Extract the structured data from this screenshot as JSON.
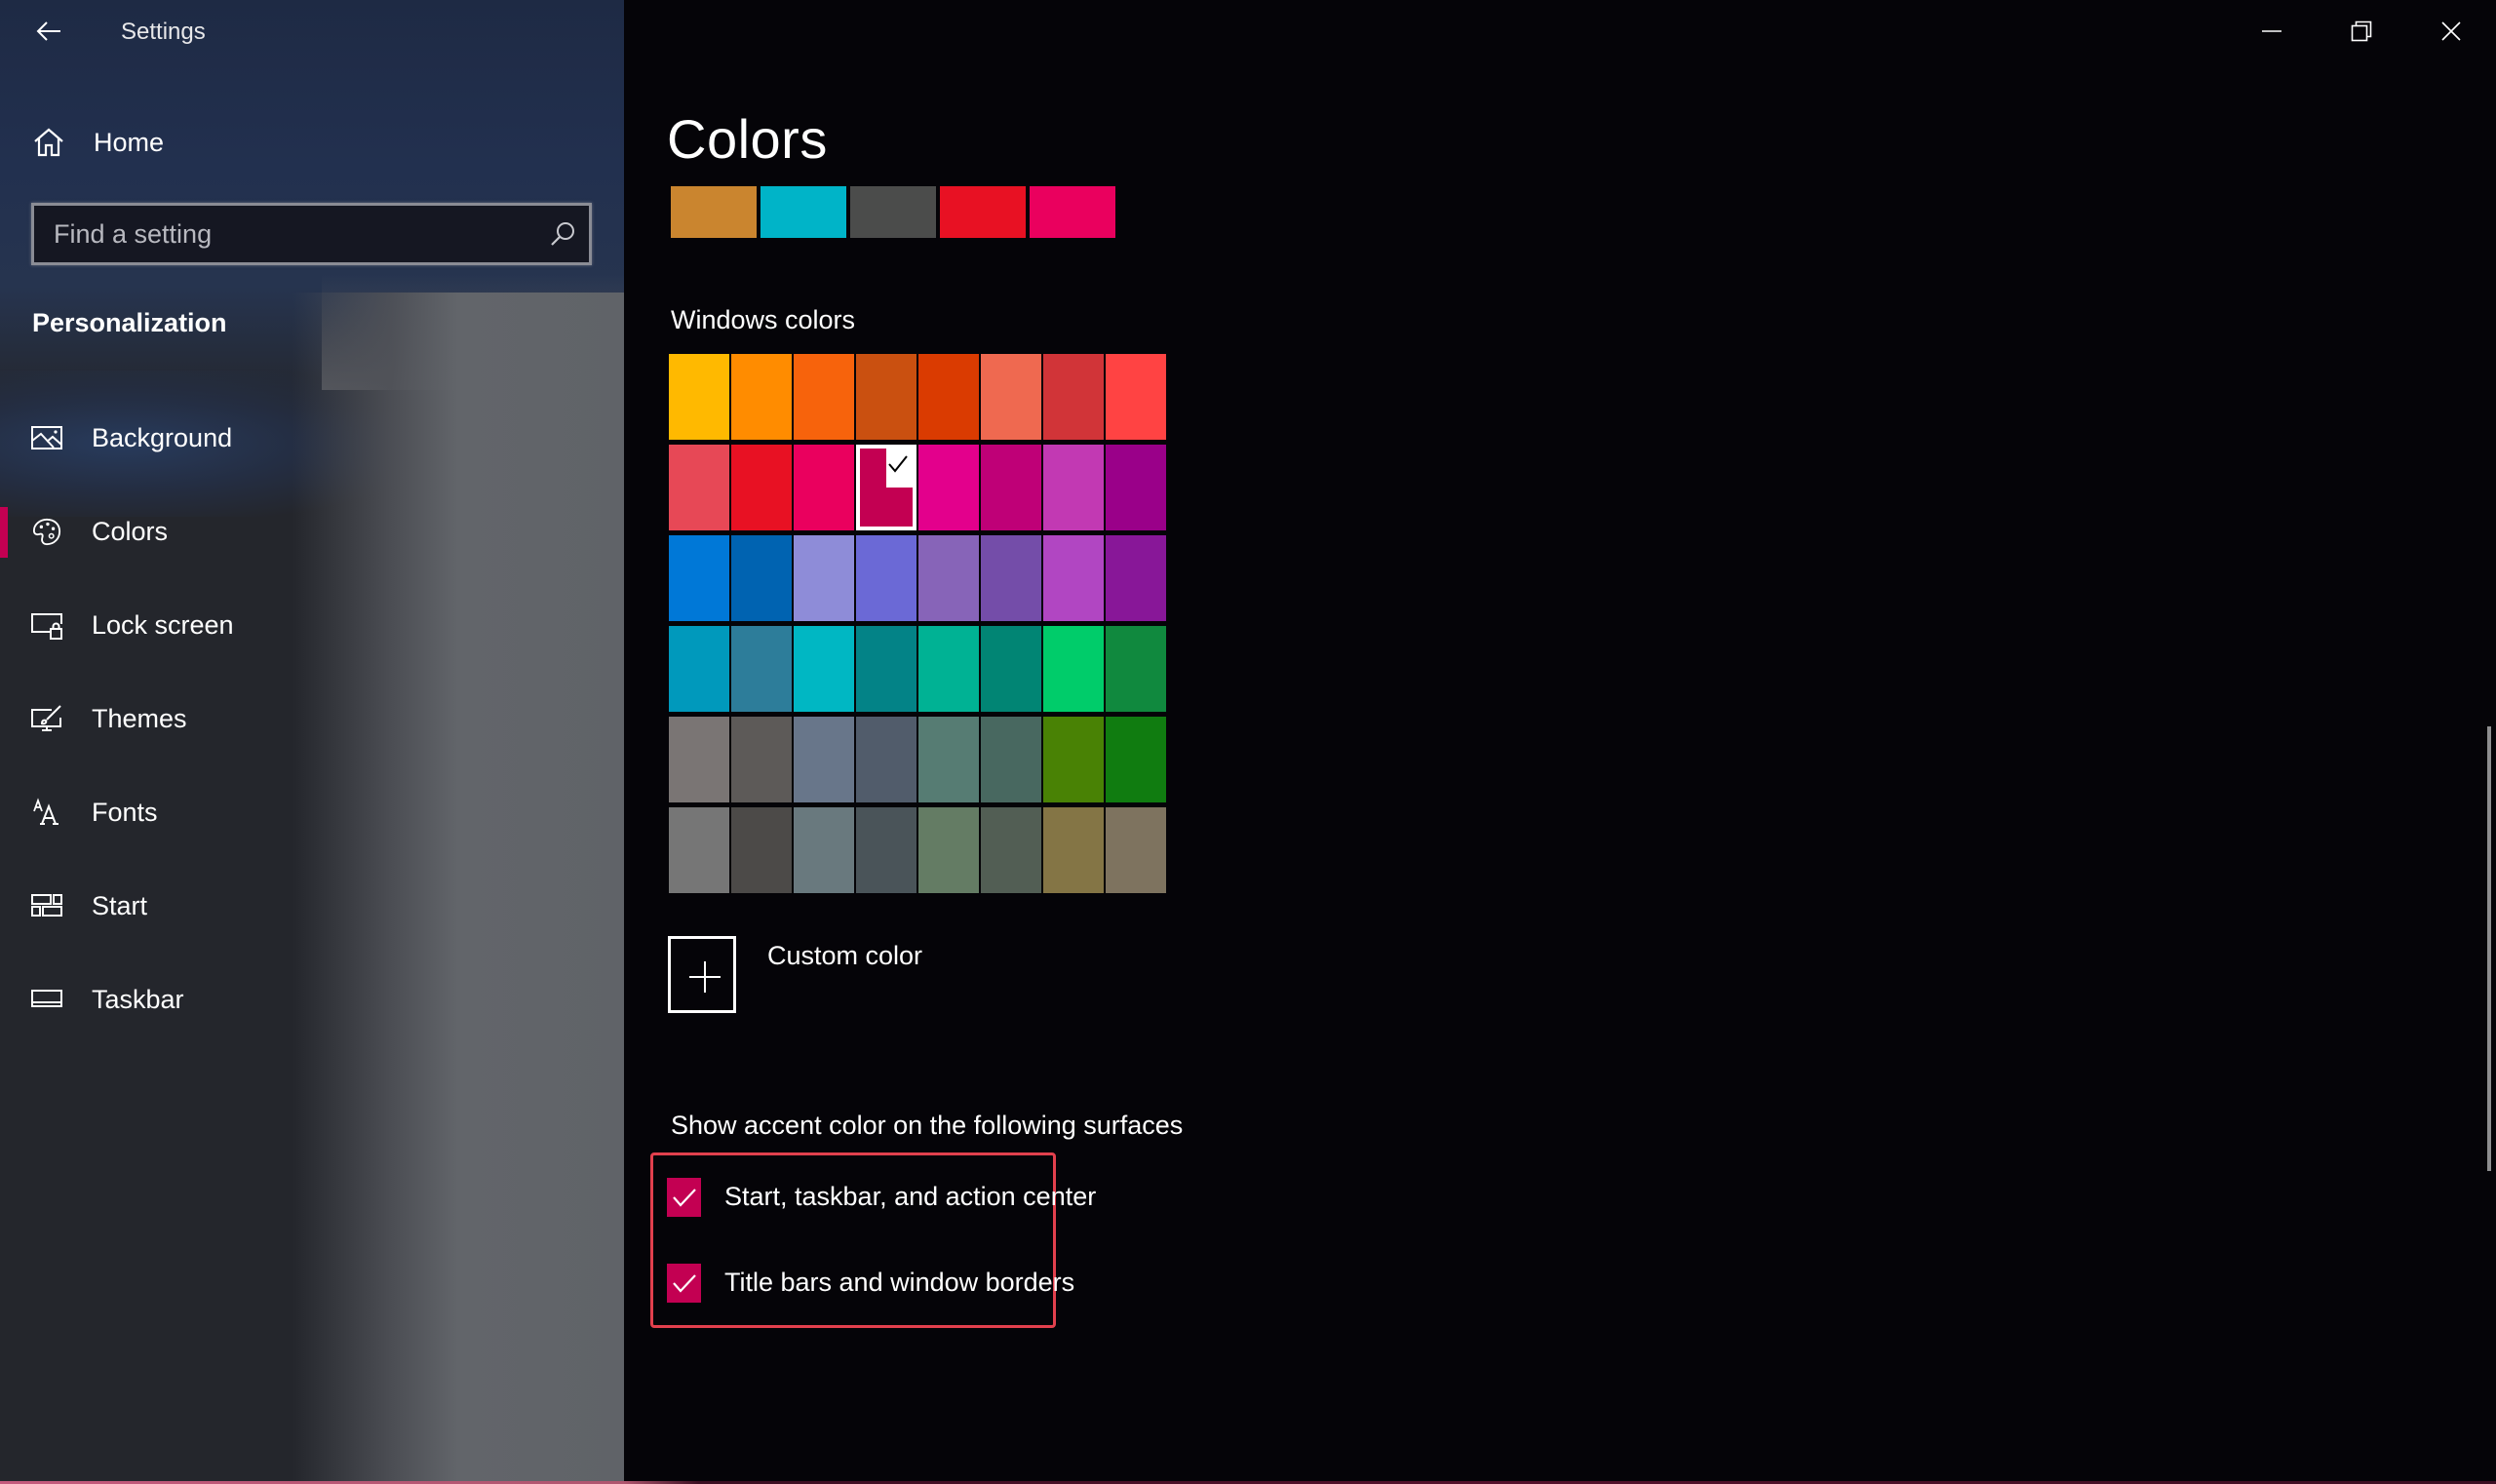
{
  "window": {
    "title": "Settings",
    "back_icon": "arrow-left-icon",
    "controls": [
      {
        "name": "minimize",
        "icon": "minimize-icon"
      },
      {
        "name": "restore",
        "icon": "restore-icon"
      },
      {
        "name": "close",
        "icon": "close-icon"
      }
    ]
  },
  "sidebar": {
    "home": {
      "label": "Home",
      "icon": "home-icon"
    },
    "search": {
      "placeholder": "Find a setting",
      "value": "",
      "icon": "search-icon"
    },
    "section_title": "Personalization",
    "items": [
      {
        "label": "Background",
        "icon": "picture-icon",
        "selected": false
      },
      {
        "label": "Colors",
        "icon": "palette-icon",
        "selected": true
      },
      {
        "label": "Lock screen",
        "icon": "lock-screen-icon",
        "selected": false
      },
      {
        "label": "Themes",
        "icon": "themes-icon",
        "selected": false
      },
      {
        "label": "Fonts",
        "icon": "fonts-icon",
        "selected": false
      },
      {
        "label": "Start",
        "icon": "start-icon",
        "selected": false
      },
      {
        "label": "Taskbar",
        "icon": "taskbar-icon",
        "selected": false
      }
    ]
  },
  "colors": {
    "accent": "#c30052",
    "highlight_border": "#e2404d"
  },
  "main": {
    "title": "Colors",
    "recent_colors": [
      "#ca852f",
      "#00b4c8",
      "#4b4c4b",
      "#e81123",
      "#ea005e"
    ],
    "windows_colors_label": "Windows colors",
    "windows_colors": [
      [
        "#ffb900",
        "#ff8c00",
        "#f7630c",
        "#ca5010",
        "#da3b01",
        "#ef6950",
        "#d13438",
        "#ff4343"
      ],
      [
        "#e74856",
        "#e81123",
        "#ea005e",
        "#c30052",
        "#e3008c",
        "#bf0077",
        "#c239b3",
        "#9a0089"
      ],
      [
        "#0078d7",
        "#0063b1",
        "#8e8cd8",
        "#6b69d6",
        "#8764b8",
        "#744da9",
        "#b146c2",
        "#881798"
      ],
      [
        "#0099bc",
        "#2d7d9a",
        "#00b7c3",
        "#038387",
        "#00b294",
        "#018574",
        "#00cc6a",
        "#10893e"
      ],
      [
        "#7a7574",
        "#5d5a58",
        "#68768a",
        "#515c6b",
        "#567c73",
        "#486860",
        "#498205",
        "#107c10"
      ],
      [
        "#767676",
        "#4c4a48",
        "#69797e",
        "#4a5459",
        "#647c64",
        "#525e54",
        "#847545",
        "#7e735f"
      ]
    ],
    "selected_color": {
      "row": 1,
      "col": 3
    },
    "custom_color_label": "Custom color",
    "surfaces_label": "Show accent color on the following surfaces",
    "checkboxes": [
      {
        "label": "Start, taskbar, and action center",
        "checked": true
      },
      {
        "label": "Title bars and window borders",
        "checked": true
      }
    ]
  }
}
